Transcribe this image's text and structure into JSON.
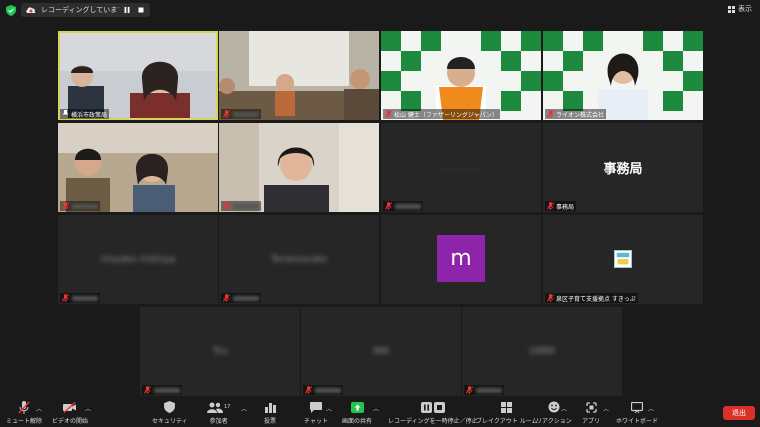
{
  "top": {
    "recording_text": "レコーディングしています...",
    "view_label": "表示"
  },
  "tiles": [
    {
      "name": "横浜市政策局"
    },
    {
      "name": ""
    },
    {
      "name": "松山 健士（ファザーリングジャパン）"
    },
    {
      "name": "ライオン株式会社"
    },
    {
      "name": ""
    },
    {
      "name": ""
    },
    {
      "name": ""
    },
    {
      "name": "事務局",
      "center": "事務局"
    },
    {
      "name": "",
      "center": "miyako nishiya"
    },
    {
      "name": "",
      "center": "Toranosuke"
    },
    {
      "name": "",
      "center": "m"
    },
    {
      "name": "泉区子育て支援拠点 すきっぷ"
    },
    {
      "name": "",
      "center": "Tru"
    },
    {
      "name": "",
      "center": "NM"
    },
    {
      "name": "",
      "center": "OMM"
    }
  ],
  "toolbar": {
    "mute": "ミュート解除",
    "video": "ビデオの開始",
    "security": "セキュリティ",
    "participants": "参加者",
    "participants_count": "17",
    "polls": "投票",
    "chat": "チャット",
    "share": "画面の共有",
    "pause_rec": "レコーディングを一時停止／停止",
    "breakout": "ブレイクアウト ルーム",
    "reactions": "リアクション",
    "apps": "アプリ",
    "whiteboard": "ホワイトボード",
    "exit": "退出"
  },
  "colors": {
    "active_border": "#d7d35b",
    "exit": "#d9302a",
    "share_green": "#23c552",
    "avatar_purple": "#8e24aa"
  }
}
